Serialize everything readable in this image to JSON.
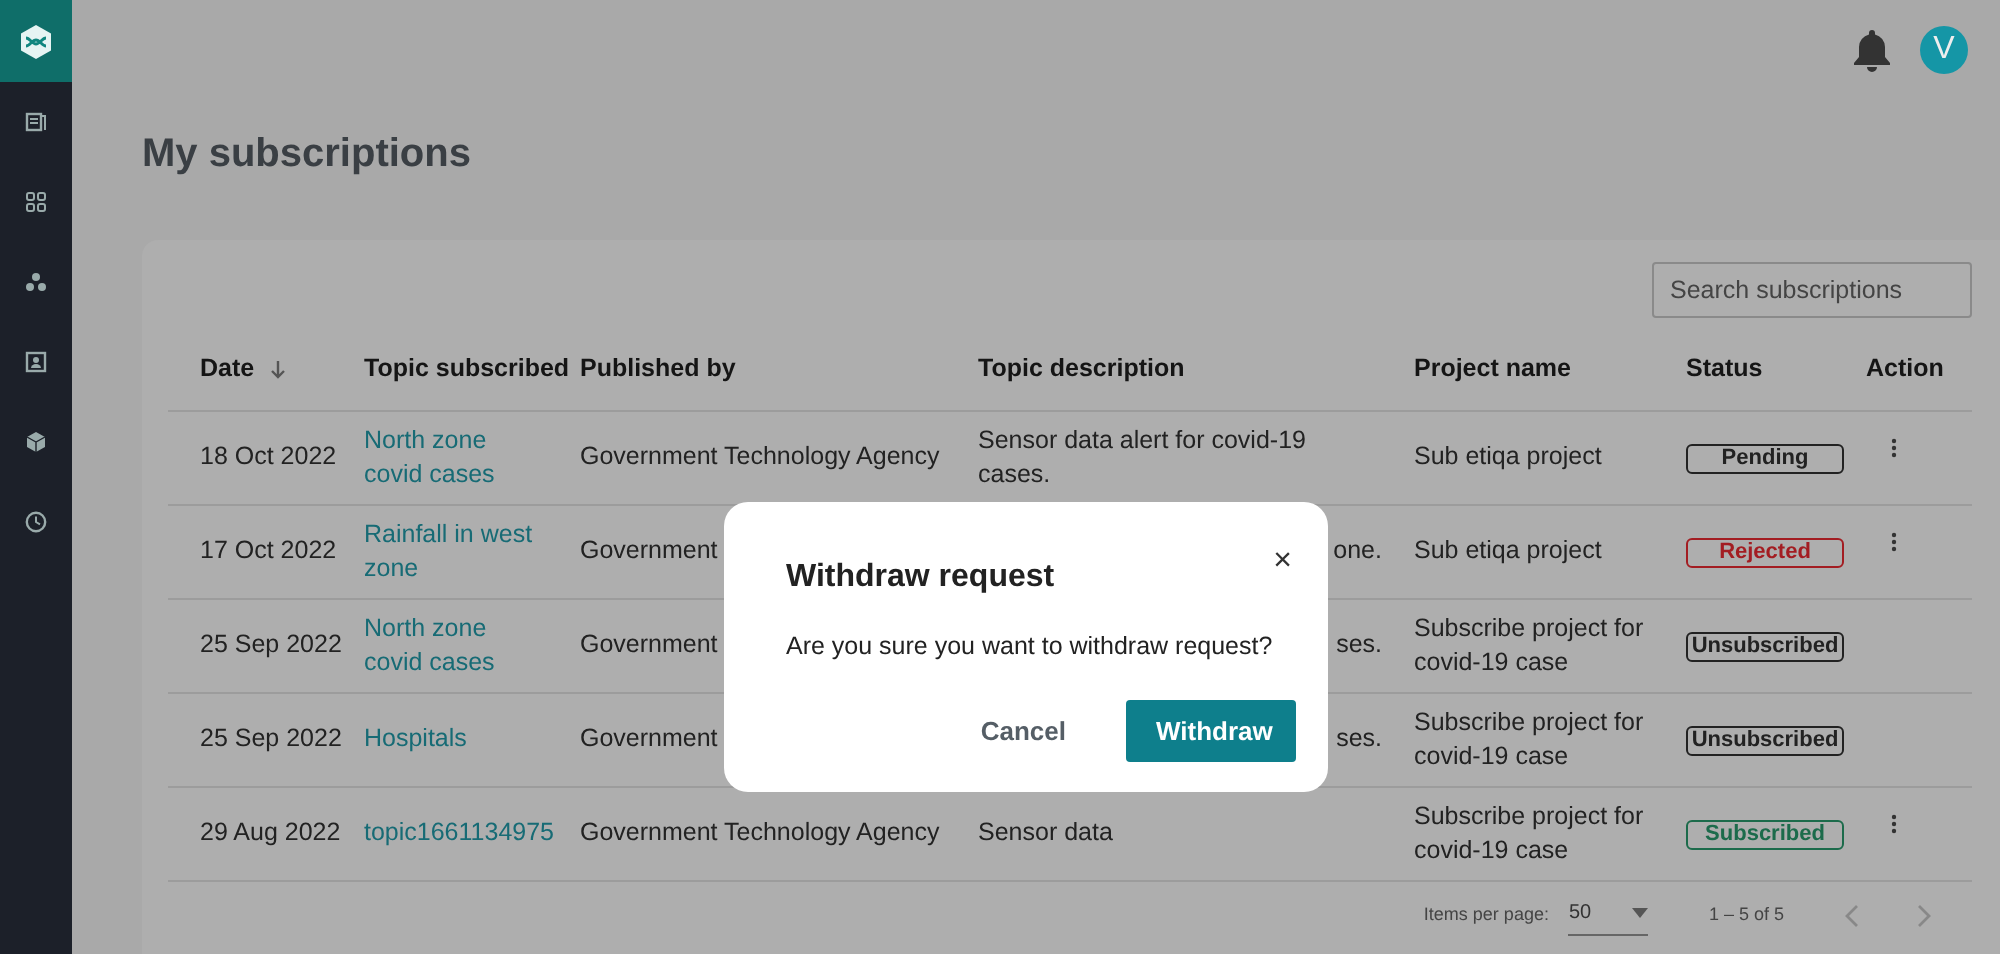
{
  "header": {
    "avatar": "V"
  },
  "page_title": "My subscriptions",
  "search": {
    "placeholder": "Search subscriptions"
  },
  "table": {
    "columns": [
      {
        "label": "Date",
        "sorted": true
      },
      {
        "label": "Topic subscribed",
        "sorted": false
      },
      {
        "label": "Published by",
        "sorted": false
      },
      {
        "label": "Topic description",
        "sorted": false
      },
      {
        "label": "Project name",
        "sorted": false
      },
      {
        "label": "Status",
        "sorted": false
      },
      {
        "label": "Action",
        "sorted": false
      }
    ],
    "rows": [
      {
        "date": "18 Oct 2022",
        "topic": "North zone covid cases",
        "published_by": "Government Technology Agency",
        "description": "Sensor data alert for covid-19 cases.",
        "description_cut": false,
        "project": "Sub etiqa project",
        "status": "Pending",
        "color": "#222222",
        "has_actions": true
      },
      {
        "date": "17 Oct 2022",
        "topic": "Rainfall in west zone",
        "published_by": "Government",
        "description": "one.",
        "description_cut": true,
        "project": "Sub etiqa project",
        "status": "Rejected",
        "color": "#a31d22",
        "has_actions": true
      },
      {
        "date": "25 Sep 2022",
        "topic": "North zone covid cases",
        "published_by": "Government",
        "description": "ses.",
        "description_cut": true,
        "project": "Subscribe project for covid-19 case",
        "status": "Unsubscribed",
        "color": "#222222",
        "has_actions": false
      },
      {
        "date": "25 Sep 2022",
        "topic": "Hospitals",
        "published_by": "Government",
        "description": "ses.",
        "description_cut": true,
        "project": "Subscribe project for covid-19 case",
        "status": "Unsubscribed",
        "color": "#222222",
        "has_actions": false
      },
      {
        "date": "29 Aug 2022",
        "topic": "topic1661134975",
        "published_by": "Government Technology Agency",
        "description": "Sensor data",
        "description_cut": false,
        "project": "Subscribe project for covid-19 case",
        "status": "Subscribed",
        "color": "#1c6b4b",
        "has_actions": true
      }
    ]
  },
  "pagination": {
    "items_per_page_label": "Items per page:",
    "items_per_page": "50",
    "range": "1 – 5 of 5"
  },
  "dialog": {
    "title": "Withdraw request",
    "close": "×",
    "message": "Are you sure you want to withdraw request?",
    "buttons": [
      {
        "label": "Cancel",
        "kind": "text"
      },
      {
        "label": "Withdraw",
        "kind": "primary"
      }
    ]
  }
}
